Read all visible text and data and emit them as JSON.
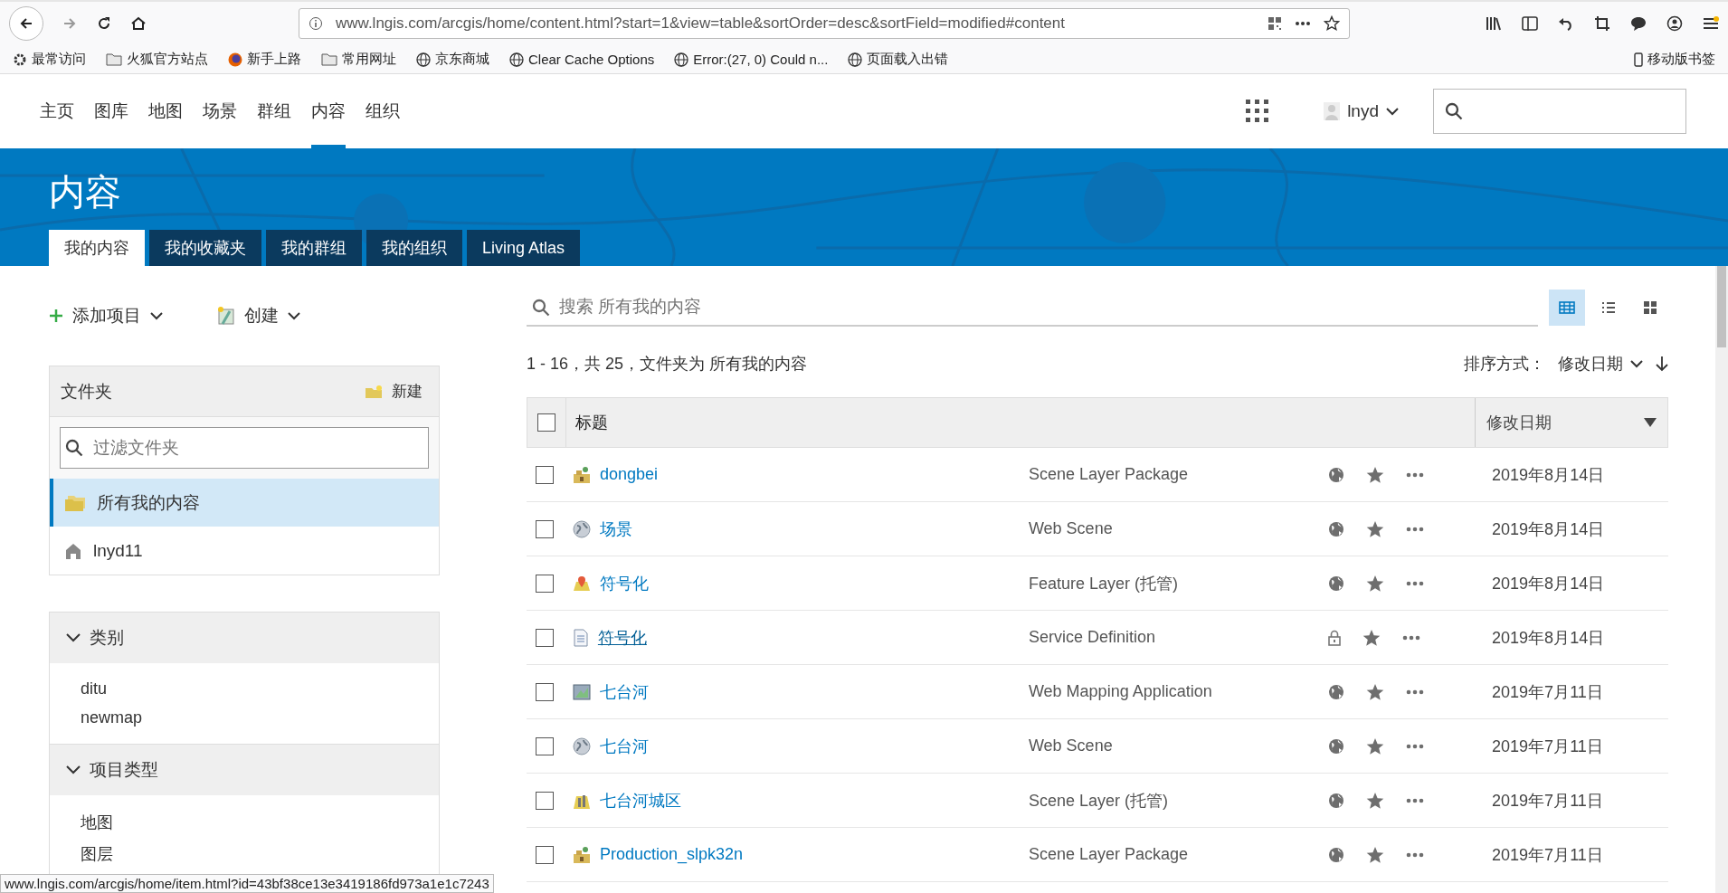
{
  "browser": {
    "url": "www.lngis.com/arcgis/home/content.html?start=1&view=table&sortOrder=desc&sortField=modified#content",
    "bookmarks": [
      {
        "label": "最常访问",
        "kind": "gear"
      },
      {
        "label": "火狐官方站点",
        "kind": "folder"
      },
      {
        "label": "新手上路",
        "kind": "firefox"
      },
      {
        "label": "常用网址",
        "kind": "folder"
      },
      {
        "label": "京东商城",
        "kind": "globe"
      },
      {
        "label": "Clear Cache Options",
        "kind": "globe"
      },
      {
        "label": "Error:(27, 0) Could n...",
        "kind": "globe"
      },
      {
        "label": "页面载入出错",
        "kind": "globe"
      }
    ],
    "mobile_bookmarks": "移动版书签",
    "status_url": "www.lngis.com/arcgis/home/item.html?id=43bf38ce13e3419186fd973a1e1c7243"
  },
  "nav": {
    "items": [
      {
        "label": "主页",
        "selected": false
      },
      {
        "label": "图库",
        "selected": false
      },
      {
        "label": "地图",
        "selected": false
      },
      {
        "label": "场景",
        "selected": false
      },
      {
        "label": "群组",
        "selected": false
      },
      {
        "label": "内容",
        "selected": true
      },
      {
        "label": "组织",
        "selected": false
      }
    ],
    "user": "lnyd"
  },
  "banner": {
    "title": "内容",
    "tabs": [
      {
        "label": "我的内容",
        "selected": true
      },
      {
        "label": "我的收藏夹",
        "selected": false
      },
      {
        "label": "我的群组",
        "selected": false
      },
      {
        "label": "我的组织",
        "selected": false
      },
      {
        "label": "Living Atlas",
        "selected": false
      }
    ]
  },
  "sidebar": {
    "add_item": "添加项目",
    "create": "创建",
    "folders": {
      "title": "文件夹",
      "new": "新建",
      "filter_placeholder": "过滤文件夹",
      "items": [
        {
          "label": "所有我的内容",
          "kind": "all",
          "selected": true
        },
        {
          "label": "lnyd11",
          "kind": "home",
          "selected": false
        }
      ]
    },
    "sections": [
      {
        "title": "类别",
        "expanded": true,
        "items": [
          "ditu",
          "newmap"
        ]
      },
      {
        "title": "项目类型",
        "expanded": true,
        "items": [
          "地图",
          "图层"
        ]
      }
    ]
  },
  "content": {
    "search_placeholder": "搜索 所有我的内容",
    "views": [
      {
        "kind": "table",
        "selected": true
      },
      {
        "kind": "list",
        "selected": false
      },
      {
        "kind": "grid",
        "selected": false
      }
    ],
    "summary": "1 - 16，共 25，文件夹为 所有我的内容",
    "sort_label": "排序方式：",
    "sort_field": "修改日期",
    "table": {
      "all_checked": false,
      "columns": [
        "标题",
        "修改日期"
      ],
      "rows": [
        {
          "checked": false,
          "kind": "package",
          "title": "dongbei",
          "hovered": false,
          "type": "Scene Layer Package",
          "shared": true,
          "date": "2019年8月14日"
        },
        {
          "checked": false,
          "kind": "scene",
          "title": "场景",
          "hovered": false,
          "type": "Web Scene",
          "shared": true,
          "date": "2019年8月14日"
        },
        {
          "checked": false,
          "kind": "feature",
          "title": "符号化",
          "hovered": false,
          "type": "Feature Layer (托管)",
          "shared": true,
          "date": "2019年8月14日"
        },
        {
          "checked": false,
          "kind": "document",
          "title": "符号化",
          "hovered": true,
          "type": "Service Definition",
          "shared": false,
          "date": "2019年8月14日"
        },
        {
          "checked": false,
          "kind": "webapp",
          "title": "七台河",
          "hovered": false,
          "type": "Web Mapping Application",
          "shared": true,
          "date": "2019年7月11日"
        },
        {
          "checked": false,
          "kind": "scene",
          "title": "七台河",
          "hovered": false,
          "type": "Web Scene",
          "shared": true,
          "date": "2019年7月11日"
        },
        {
          "checked": false,
          "kind": "scenelayer",
          "title": "七台河城区",
          "hovered": false,
          "type": "Scene Layer (托管)",
          "shared": true,
          "date": "2019年7月11日"
        },
        {
          "checked": false,
          "kind": "package",
          "title": "Production_slpk32n",
          "hovered": false,
          "type": "Scene Layer Package",
          "shared": true,
          "date": "2019年7月11日"
        }
      ]
    }
  }
}
